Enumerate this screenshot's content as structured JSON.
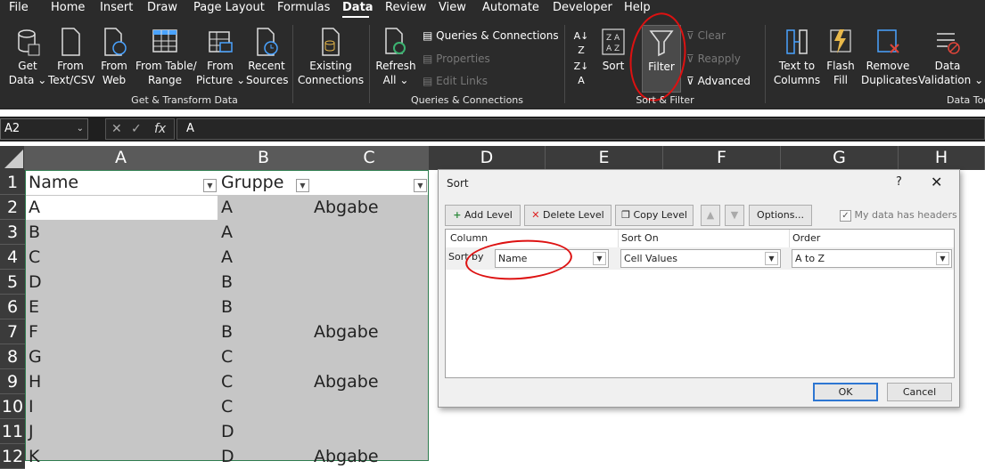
{
  "menu": [
    "File",
    "Home",
    "Insert",
    "Draw",
    "Page Layout",
    "Formulas",
    "Data",
    "Review",
    "View",
    "Automate",
    "Developer",
    "Help"
  ],
  "menu_active": "Data",
  "ribbon": {
    "get_data": [
      "Get",
      "Data ⌄"
    ],
    "from_text": [
      "From",
      "Text/CSV"
    ],
    "from_web": [
      "From",
      "Web"
    ],
    "from_table": [
      "From Table/",
      "Range"
    ],
    "from_picture": [
      "From",
      "Picture ⌄"
    ],
    "recent_sources": [
      "Recent",
      "Sources"
    ],
    "existing_connections": [
      "Existing",
      "Connections"
    ],
    "group_get_transform": "Get & Transform Data",
    "refresh_all": [
      "Refresh",
      "All ⌄"
    ],
    "queries_connections": "Queries & Connections",
    "properties": "Properties",
    "edit_links": "Edit Links",
    "group_queries": "Queries & Connections",
    "sort": "Sort",
    "filter": "Filter",
    "clear": "Clear",
    "reapply": "Reapply",
    "advanced": "Advanced",
    "group_sort_filter": "Sort & Filter",
    "text_to_columns": [
      "Text to",
      "Columns"
    ],
    "flash_fill": [
      "Flash",
      "Fill"
    ],
    "remove_duplicates": [
      "Remove",
      "Duplicates"
    ],
    "data_validation": [
      "Data",
      "Validation ⌄"
    ],
    "group_data_tools": "Data Tools"
  },
  "formula_bar": {
    "name_box": "A2",
    "formula": "A"
  },
  "sheet": {
    "columns": [
      "A",
      "B",
      "C",
      "D",
      "E",
      "F",
      "G",
      "H"
    ],
    "rows": [
      "1",
      "2",
      "3",
      "4",
      "5",
      "6",
      "7",
      "8",
      "9",
      "10",
      "11",
      "12"
    ],
    "header_row": [
      "Name",
      "Gruppe",
      ""
    ],
    "data": [
      [
        "A",
        "A",
        "Abgabe"
      ],
      [
        "B",
        "A",
        ""
      ],
      [
        "C",
        "A",
        ""
      ],
      [
        "D",
        "B",
        ""
      ],
      [
        "E",
        "B",
        ""
      ],
      [
        "F",
        "B",
        "Abgabe"
      ],
      [
        "G",
        "C",
        ""
      ],
      [
        "H",
        "C",
        "Abgabe"
      ],
      [
        "I",
        "C",
        ""
      ],
      [
        "J",
        "D",
        ""
      ],
      [
        "K",
        "D",
        "Abgabe"
      ]
    ]
  },
  "dialog": {
    "title": "Sort",
    "help": "?",
    "close": "✕",
    "add_level": "Add Level",
    "delete_level": "Delete Level",
    "copy_level": "Copy Level",
    "options": "Options...",
    "my_data_has_headers": "My data has headers",
    "headers_checked": true,
    "col_header": "Column",
    "sort_on_header": "Sort On",
    "order_header": "Order",
    "sort_by": "Sort by",
    "column_value": "Name",
    "sort_on_value": "Cell Values",
    "order_value": "A to Z",
    "ok": "OK",
    "cancel": "Cancel"
  }
}
